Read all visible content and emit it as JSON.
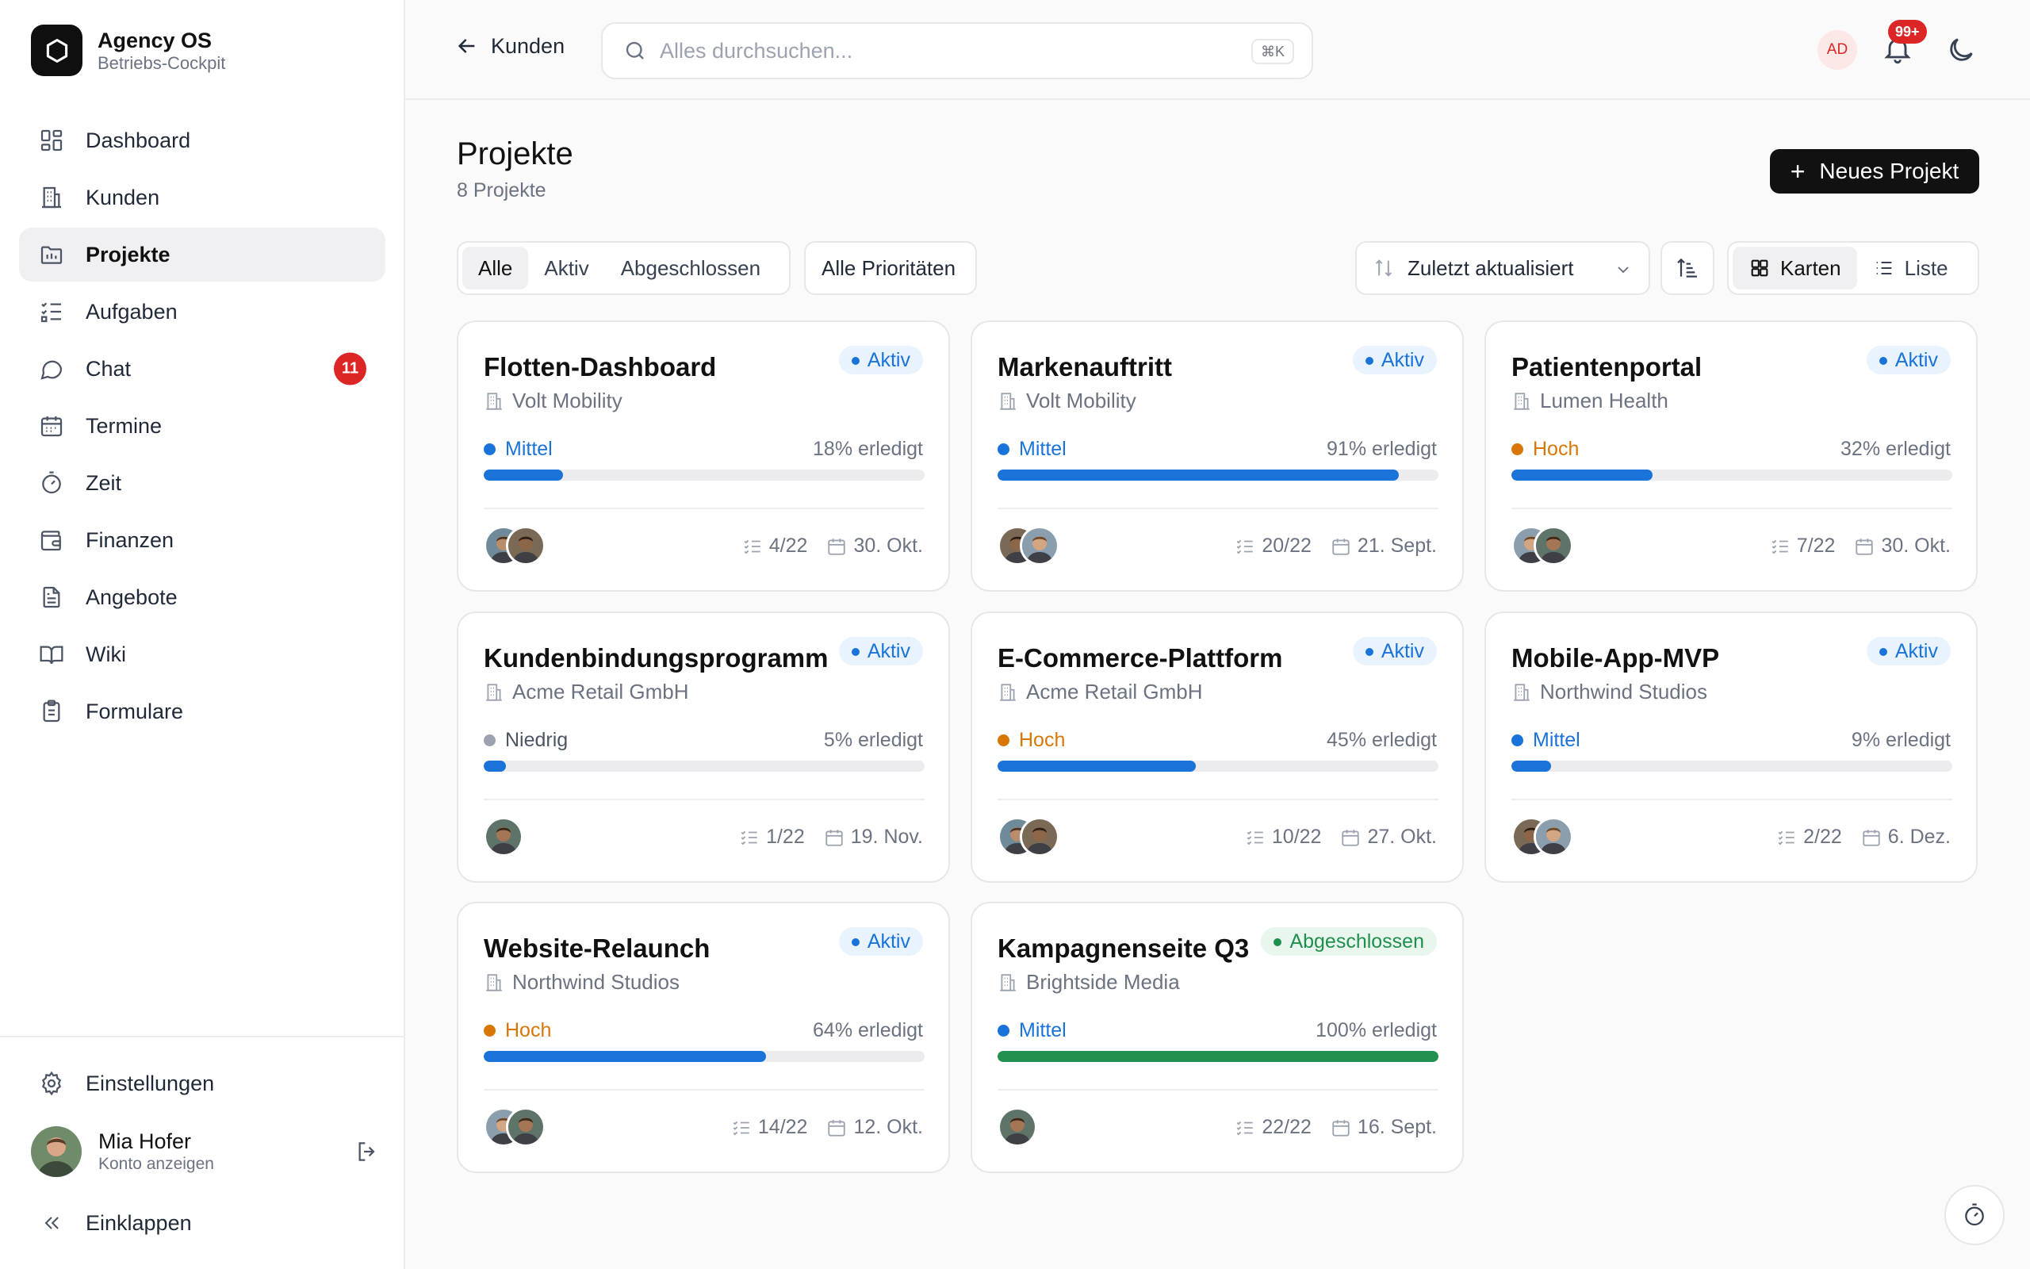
{
  "brand": {
    "name": "Agency OS",
    "subtitle": "Betriebs-Cockpit"
  },
  "nav": [
    {
      "label": "Dashboard",
      "icon": "dashboard-icon"
    },
    {
      "label": "Kunden",
      "icon": "building-icon"
    },
    {
      "label": "Projekte",
      "icon": "folder-icon",
      "active": true
    },
    {
      "label": "Aufgaben",
      "icon": "checklist-icon"
    },
    {
      "label": "Chat",
      "icon": "chat-icon",
      "badge": "11"
    },
    {
      "label": "Termine",
      "icon": "calendar-icon"
    },
    {
      "label": "Zeit",
      "icon": "stopwatch-icon"
    },
    {
      "label": "Finanzen",
      "icon": "wallet-icon"
    },
    {
      "label": "Angebote",
      "icon": "document-icon"
    },
    {
      "label": "Wiki",
      "icon": "book-icon"
    },
    {
      "label": "Formulare",
      "icon": "clipboard-icon"
    }
  ],
  "settings_label": "Einstellungen",
  "user": {
    "name": "Mia Hofer",
    "sub": "Konto anzeigen"
  },
  "collapse_label": "Einklappen",
  "topbar": {
    "back_label": "Kunden",
    "search_placeholder": "Alles durchsuchen...",
    "search_shortcut": "⌘K",
    "user_initials": "AD",
    "notification_count": "99+"
  },
  "page": {
    "title": "Projekte",
    "count_label": "8 Projekte",
    "new_button": "Neues Projekt"
  },
  "filters": {
    "status_tabs": [
      "Alle",
      "Aktiv",
      "Abgeschlossen"
    ],
    "active_tab": 0,
    "priority_value": "Alle Prioritäten",
    "sort_value": "Zuletzt aktualisiert",
    "view_options": [
      "Karten",
      "Liste"
    ],
    "active_view": 0
  },
  "colors": {
    "priority": {
      "Mittel": "#1a73d9",
      "Hoch": "#d97706",
      "Niedrig": "#9ca3af"
    },
    "bar_active": "#1a73d9",
    "bar_done": "#22914f"
  },
  "projects": [
    {
      "title": "Flotten-Dashboard",
      "client": "Volt Mobility",
      "status": "Aktiv",
      "status_type": "aktiv",
      "priority": "Mittel",
      "progress": 18,
      "progress_label": "18% erledigt",
      "tasks": "4/22",
      "due": "30. Okt.",
      "avatars": 2
    },
    {
      "title": "Markenauftritt",
      "client": "Volt Mobility",
      "status": "Aktiv",
      "status_type": "aktiv",
      "priority": "Mittel",
      "progress": 91,
      "progress_label": "91% erledigt",
      "tasks": "20/22",
      "due": "21. Sept.",
      "avatars": 2
    },
    {
      "title": "Patientenportal",
      "client": "Lumen Health",
      "status": "Aktiv",
      "status_type": "aktiv",
      "priority": "Hoch",
      "progress": 32,
      "progress_label": "32% erledigt",
      "tasks": "7/22",
      "due": "30. Okt.",
      "avatars": 2
    },
    {
      "title": "Kundenbindungsprogramm",
      "client": "Acme Retail GmbH",
      "status": "Aktiv",
      "status_type": "aktiv",
      "priority": "Niedrig",
      "progress": 5,
      "progress_label": "5% erledigt",
      "tasks": "1/22",
      "due": "19. Nov.",
      "avatars": 1
    },
    {
      "title": "E-Commerce-Plattform",
      "client": "Acme Retail GmbH",
      "status": "Aktiv",
      "status_type": "aktiv",
      "priority": "Hoch",
      "progress": 45,
      "progress_label": "45% erledigt",
      "tasks": "10/22",
      "due": "27. Okt.",
      "avatars": 2
    },
    {
      "title": "Mobile-App-MVP",
      "client": "Northwind Studios",
      "status": "Aktiv",
      "status_type": "aktiv",
      "priority": "Mittel",
      "progress": 9,
      "progress_label": "9% erledigt",
      "tasks": "2/22",
      "due": "6. Dez.",
      "avatars": 2
    },
    {
      "title": "Website-Relaunch",
      "client": "Northwind Studios",
      "status": "Aktiv",
      "status_type": "aktiv",
      "priority": "Hoch",
      "progress": 64,
      "progress_label": "64% erledigt",
      "tasks": "14/22",
      "due": "12. Okt.",
      "avatars": 2
    },
    {
      "title": "Kampagnenseite Q3",
      "client": "Brightside Media",
      "status": "Abgeschlossen",
      "status_type": "done",
      "priority": "Mittel",
      "progress": 100,
      "progress_label": "100% erledigt",
      "tasks": "22/22",
      "due": "16. Sept.",
      "avatars": 1
    }
  ]
}
